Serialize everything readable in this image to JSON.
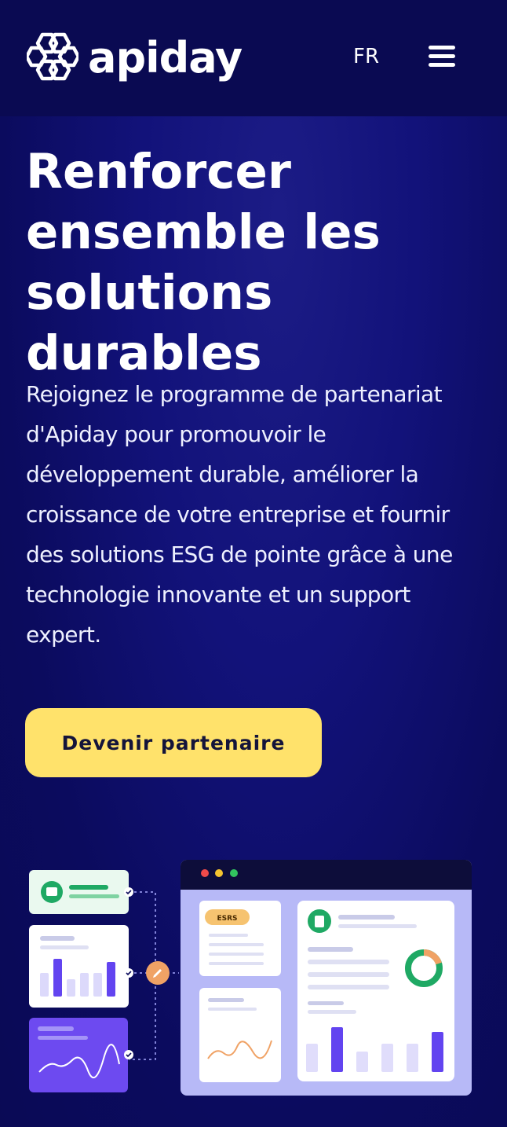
{
  "header": {
    "logo_text": "apiday",
    "language": "FR",
    "menu_icon": "hamburger-menu-icon"
  },
  "hero": {
    "title_line1": "Renforcer",
    "title_highlight": "ensemble",
    "title_line2_rest": " les",
    "title_line3": "solutions durables",
    "description": "Rejoignez le programme de partenariat d'Apiday pour promouvoir le développement durable, améliorer la croissance de votre entreprise et fournir des solutions ESG de pointe grâce à une technologie innovante et un support expert.",
    "cta_label": "Devenir partenaire"
  },
  "illustration": {
    "badge": "ESRS"
  },
  "colors": {
    "header_bg": "#0a0a52",
    "hero_bg": "#12127a",
    "highlight": "#4e5bea",
    "cta_bg": "#ffe26b",
    "accent_purple": "#6244f0",
    "accent_green": "#1fa964",
    "accent_orange": "#f0a265"
  }
}
